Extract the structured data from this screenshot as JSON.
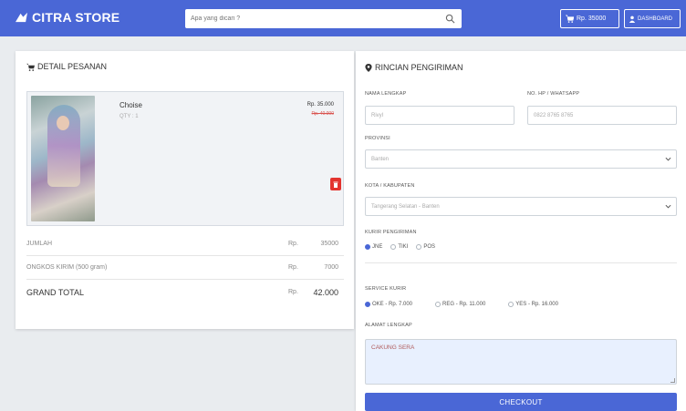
{
  "navbar": {
    "brand": "CITRA STORE",
    "search_placeholder": "Apa yang dicari ?",
    "cart_label": "Rp. 35000",
    "dashboard_label": "DASHBOARD",
    "color": "#4a67d6"
  },
  "order": {
    "title": "DETAIL PESANAN",
    "item": {
      "name": "Choise",
      "qty": "QTY : 1",
      "price": "Rp. 35.000",
      "old_price": "Rp. 40.000"
    },
    "summary": [
      {
        "label": "JUMLAH",
        "currency": "Rp.",
        "value": "35000"
      },
      {
        "label": "ONGKOS KIRIM (500 gram)",
        "currency": "Rp.",
        "value": "7000"
      }
    ],
    "grand_total": {
      "label": "GRAND TOTAL",
      "currency": "Rp.",
      "value": "42.000"
    }
  },
  "shipping": {
    "title": "RINCIAN PENGIRIMAN",
    "name_label": "NAMA LENGKAP",
    "name_value": "Rivyl",
    "phone_label": "NO. HP / WHATSAPP",
    "phone_value": "0822 8765 8765",
    "province_label": "PROVINSI",
    "province_value": "Banten",
    "city_label": "KOTA / KABUPATEN",
    "city_value": "Tangerang Selatan - Banten",
    "courier_label": "KURIR PENGIRIMAN",
    "couriers": [
      "JNE",
      "TIKI",
      "POS"
    ],
    "service_label": "SERVICE KURIR",
    "services": [
      "OKE - Rp. 7.000",
      "REG - Rp. 11.000",
      "YES - Rp. 16.000"
    ],
    "address_label": "ALAMAT LENGKAP",
    "address_value": "CAKUNG SERA",
    "checkout_label": "CHECKOUT",
    "accent_color": "#4a67d6"
  }
}
